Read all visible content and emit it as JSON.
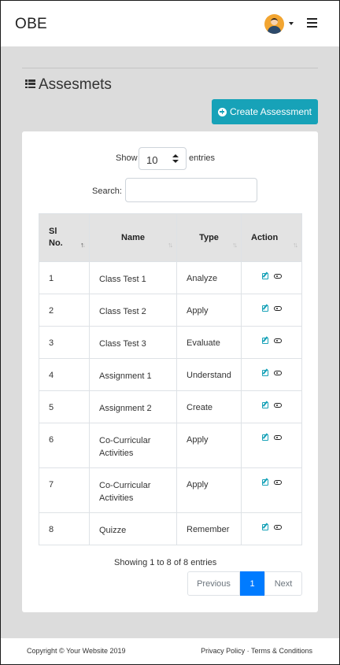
{
  "header": {
    "brand": "OBE"
  },
  "page": {
    "title": "Assesmets",
    "create_label": "Create Assessment"
  },
  "controls": {
    "show_label": "Show",
    "entries_value": "10",
    "entries_label": "entries",
    "search_label": "Search:"
  },
  "table": {
    "headers": [
      "Sl No.",
      "Name",
      "Type",
      "Action"
    ],
    "rows": [
      {
        "no": "1",
        "name": "Class Test 1",
        "type": "Analyze"
      },
      {
        "no": "2",
        "name": "Class Test 2",
        "type": "Apply"
      },
      {
        "no": "3",
        "name": "Class Test 3",
        "type": "Evaluate"
      },
      {
        "no": "4",
        "name": "Assignment 1",
        "type": "Understand"
      },
      {
        "no": "5",
        "name": "Assignment 2",
        "type": "Create"
      },
      {
        "no": "6",
        "name": "Co-Curricular Activities",
        "type": "Apply"
      },
      {
        "no": "7",
        "name": "Co-Curricular Activities",
        "type": "Apply"
      },
      {
        "no": "8",
        "name": "Quizze",
        "type": "Remember"
      }
    ]
  },
  "pagination": {
    "info": "Showing 1 to 8 of 8 entries",
    "previous": "Previous",
    "current": "1",
    "next": "Next"
  },
  "footer": {
    "copyright": "Copyright © Your Website 2019",
    "links": "Privacy Policy · Terms & Conditions"
  },
  "colors": {
    "accent": "#17a2b8",
    "primary": "#007bff",
    "background": "#dcdcdc"
  }
}
